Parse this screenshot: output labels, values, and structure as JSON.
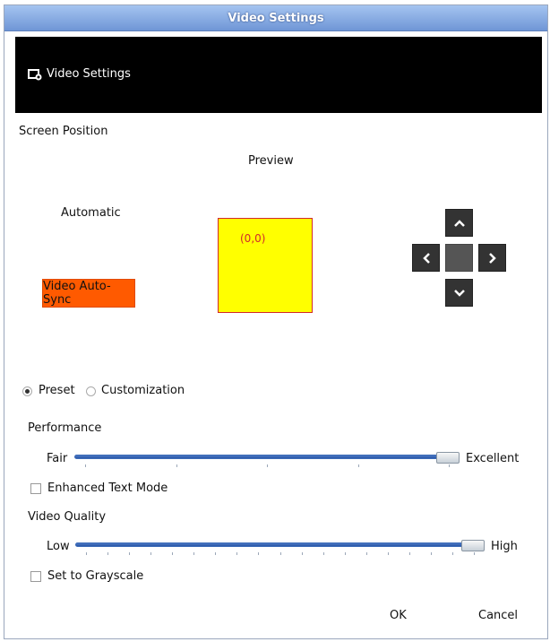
{
  "window": {
    "title": "Video Settings"
  },
  "banner": {
    "icon": "video-settings-icon",
    "label": "Video Settings"
  },
  "screen_position": {
    "heading": "Screen Position",
    "preview_label": "Preview",
    "automatic_label": "Automatic",
    "auto_sync_button": "Video Auto-Sync",
    "preview_coord": "(0,0)",
    "dpad_icons": [
      "arrow-up-icon",
      "arrow-left-icon",
      "arrow-right-icon",
      "arrow-down-icon"
    ]
  },
  "mode": {
    "options": [
      {
        "label": "Preset",
        "checked": true
      },
      {
        "label": "Customization",
        "checked": false
      }
    ]
  },
  "performance": {
    "heading": "Performance",
    "min_label": "Fair",
    "max_label": "Excellent",
    "value_fraction": 1.0
  },
  "enhanced_text": {
    "label": "Enhanced Text Mode",
    "checked": false
  },
  "video_quality": {
    "heading": "Video Quality",
    "min_label": "Low",
    "max_label": "High",
    "value_fraction": 1.0
  },
  "grayscale": {
    "label": "Set to Grayscale",
    "checked": false
  },
  "footer": {
    "ok_label": "OK",
    "cancel_label": "Cancel"
  },
  "colors": {
    "accent_orange": "#ff5a00",
    "preview_yellow": "#ffff00",
    "coord_red": "#d12a2a",
    "slider_blue": "#3c6bb8"
  }
}
